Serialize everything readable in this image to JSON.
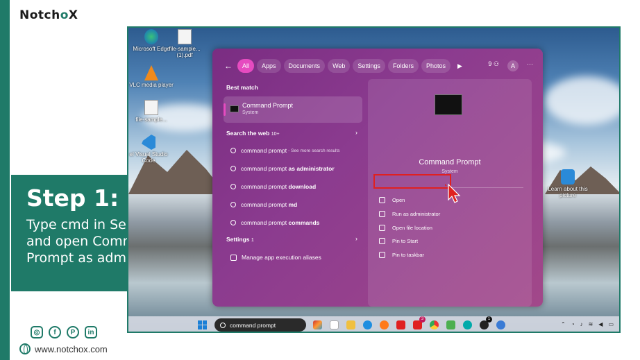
{
  "brand": {
    "name_part1": "Notch",
    "name_o": "o",
    "name_x": "X"
  },
  "step": {
    "title": "Step 1:",
    "description": "Type cmd in Search bar and open Command Prompt as administrator"
  },
  "social": {
    "icons": [
      "instagram-icon",
      "facebook-icon",
      "pinterest-icon",
      "linkedin-icon"
    ],
    "website": "www.notchox.com"
  },
  "desktop": {
    "icons": [
      {
        "name": "edge",
        "label": "Microsoft Edge"
      },
      {
        "name": "pdf",
        "label": "file-sample...(1).pdf"
      },
      {
        "name": "vlc",
        "label": "VLC media player"
      },
      {
        "name": "file",
        "label": "file-sample..."
      },
      {
        "name": "vscode",
        "label": "el Visual Studio Code"
      },
      {
        "name": "learn",
        "label": "Learn about this picture"
      }
    ]
  },
  "start_menu": {
    "filters": [
      "All",
      "Apps",
      "Documents",
      "Web",
      "Settings",
      "Folders",
      "Photos"
    ],
    "active_filter": "All",
    "rewards": "9",
    "avatar": "A",
    "best_match_heading": "Best match",
    "best_match": {
      "title": "Command Prompt",
      "subtitle": "System"
    },
    "search_web_heading": "Search the web",
    "search_web_count": "10+",
    "web_results": [
      {
        "normal": "command prompt",
        "bold": "",
        "suffix": " - See more search results"
      },
      {
        "normal": "command prompt ",
        "bold": "as administrator",
        "suffix": ""
      },
      {
        "normal": "command prompt ",
        "bold": "download",
        "suffix": ""
      },
      {
        "normal": "command prompt ",
        "bold": "md",
        "suffix": ""
      },
      {
        "normal": "command prompt ",
        "bold": "commands",
        "suffix": ""
      }
    ],
    "settings_heading": "Settings",
    "settings_count": "1",
    "settings_item": "Manage app execution aliases",
    "detail": {
      "title": "Command Prompt",
      "subtitle": "System",
      "actions": [
        "Open",
        "Run as administrator",
        "Open file location",
        "Pin to Start",
        "Pin to taskbar"
      ]
    }
  },
  "taskbar": {
    "search_text": "command prompt",
    "badges": [
      "3",
      "1"
    ]
  },
  "colors": {
    "brand": "#1f7a68",
    "accent": "#e64bc0",
    "highlight": "#e02020"
  }
}
